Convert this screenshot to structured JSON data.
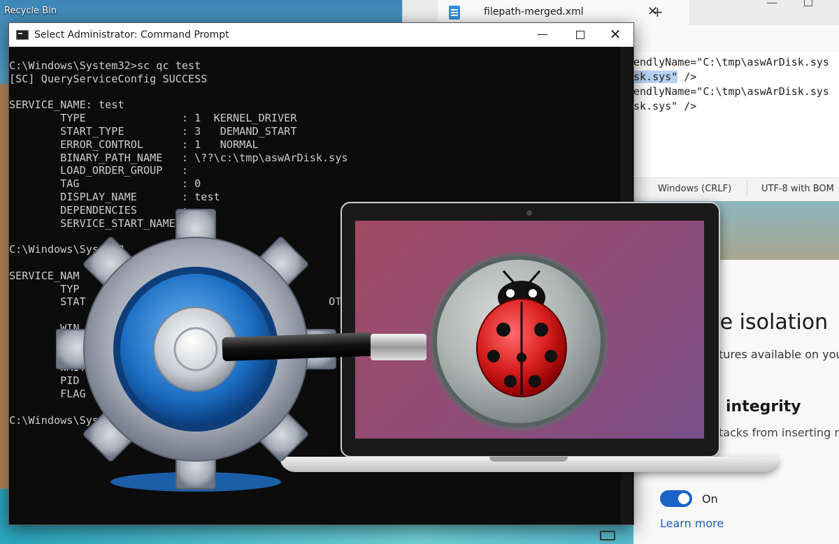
{
  "desktop": {
    "recycle_bin_label": "Recycle Bin"
  },
  "notepad": {
    "tab_title": "filepath-merged.xml",
    "lines": [
      "endlyName=\"C:\\tmp\\aswArDisk.sys",
      "sk.sys\" />",
      "endlyName=\"C:\\tmp\\aswArDisk.sys",
      "sk.sys\" />"
    ],
    "line2_highlight": "sk.sys\"",
    "line2_rest": " />",
    "status_eol": "Windows (CRLF)",
    "status_encoding": "UTF-8 with BOM"
  },
  "security": {
    "title": "re isolation",
    "subtitle": "tures available on you",
    "heading": "integrity",
    "description": "tacks from inserting m",
    "toggle_label": "On",
    "toggle_state": "on",
    "link": "Learn more"
  },
  "cmd": {
    "window_title": "Select Administrator: Command Prompt",
    "minimize_glyph": "—",
    "close_glyph": "✕",
    "lines": [
      "C:\\Windows\\System32>sc qc test",
      "[SC] QueryServiceConfig SUCCESS",
      "",
      "SERVICE_NAME: test",
      "        TYPE               : 1  KERNEL_DRIVER",
      "        START_TYPE         : 3   DEMAND_START",
      "        ERROR_CONTROL      : 1   NORMAL",
      "        BINARY_PATH_NAME   : \\??\\c:\\tmp\\aswArDisk.sys",
      "        LOAD_ORDER_GROUP   :",
      "        TAG                : 0",
      "        DISPLAY_NAME       : test",
      "        DEPENDENCIES       :",
      "        SERVICE_START_NAME :",
      "",
      "C:\\Windows\\System3",
      "",
      "SERVICE_NAM",
      "        TYP",
      "        STAT                                      OT_PA",
      "",
      "        WIN",
      "",
      "",
      "        WAIT",
      "        PID",
      "        FLAG",
      "",
      "C:\\Windows\\Syste"
    ]
  },
  "colors": {
    "cmd_bg": "#0c0c0c",
    "cmd_text": "#cccccc",
    "toggle_on": "#1a63c7",
    "link": "#1a5fb4",
    "laptop_screen": "#8c4d7a",
    "ladybug": "#d81e1e"
  },
  "icons": {
    "recycle_bin": "recycle-bin-icon",
    "notepad": "notepad-icon",
    "cmd": "cmd-icon",
    "gear": "gear-icon",
    "magnifier": "magnifying-glass-icon",
    "ladybug": "ladybug-icon"
  }
}
